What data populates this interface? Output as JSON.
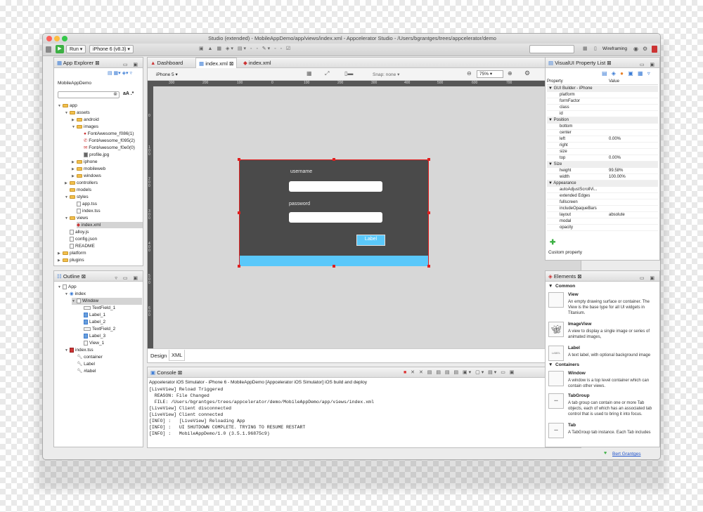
{
  "window": {
    "title": "Studio (extended) - MobileAppDemo/app/views/index.xml - Appcelerator Studio - /Users/bgrantges/trees/appcelerator/demo"
  },
  "toolbar": {
    "run_label": "Run",
    "device_label": "iPhone 6 (v8.3)",
    "wireframing_label": "Wireframing"
  },
  "explorer": {
    "title": "App Explorer",
    "project": "MobileAppDemo",
    "filter_buttons": "aA .*",
    "items": [
      "app",
      "assets",
      "android",
      "images",
      "FontAwesome_f086(1)",
      "FontAwesome_f095(2)",
      "FontAwesome_f0e0(0)",
      "profile.jpg",
      "iphone",
      "mobileweb",
      "windows",
      "controllers",
      "models",
      "styles",
      "app.tss",
      "index.tss",
      "views",
      "index.xml",
      "alloy.js",
      "config.json",
      "README",
      "platform",
      "plugins"
    ]
  },
  "outline": {
    "title": "Outline",
    "items": [
      "App",
      "index",
      "Window",
      "TextField_1",
      "Label_1",
      "Label_2",
      "TextField_2",
      "Label_3",
      "View_1",
      "index.tss",
      "container",
      "Label",
      "#label"
    ]
  },
  "editor": {
    "tabs": [
      "Dashboard",
      "index.xml",
      "index.xml"
    ],
    "device": "iPhone 5",
    "snap": "Snap: none",
    "zoom": "75%",
    "ruler_top": [
      "300",
      "200",
      "100",
      "0",
      "100",
      "200",
      "300",
      "400",
      "500",
      "600",
      "700"
    ],
    "ruler_left": [
      "0",
      "1\n0\n0",
      "2\n0\n0",
      "3\n0\n0",
      "4\n0\n0",
      "5\n0\n0",
      "6\n0\n0"
    ],
    "username_label": "username",
    "password_label": "password",
    "button_label": "Label",
    "bottom_tabs": [
      "Design",
      "XML"
    ]
  },
  "console": {
    "title": "Console",
    "header": "Appcelerator iOS Simulator - iPhone 6 - MobileAppDemo [Appcelerator iOS Simulator] iOS build and deploy",
    "lines": [
      "[LiveView] Reload Triggered",
      "  REASON: File Changed",
      "  FILE: /Users/bgrantges/trees/appcelerator/demo/MobileAppDemo/app/views/index.xml",
      "[LiveView] Client disconnected",
      "[LiveView] Client connected",
      "[INFO] :   [LiveView] Reloading App",
      "[INFO] :   UI SHUTDOWN COMPLETE. TRYING TO RESUME RESTART",
      "[INFO] :   MobileAppDemo/1.0 (3.5.1.96875c9)"
    ]
  },
  "properties": {
    "title": "VisualUI Property List",
    "col_property": "Property",
    "col_value": "Value",
    "rows": [
      {
        "name": "GUI Builder - iPhone",
        "value": "",
        "group": true
      },
      {
        "name": "platform",
        "value": ""
      },
      {
        "name": "formFactor",
        "value": ""
      },
      {
        "name": "class",
        "value": ""
      },
      {
        "name": "id",
        "value": ""
      },
      {
        "name": "Position",
        "value": "",
        "group": true
      },
      {
        "name": "bottom",
        "value": ""
      },
      {
        "name": "center",
        "value": ""
      },
      {
        "name": "left",
        "value": "0.00%"
      },
      {
        "name": "right",
        "value": ""
      },
      {
        "name": "size",
        "value": ""
      },
      {
        "name": "top",
        "value": "0.00%"
      },
      {
        "name": "Size",
        "value": "",
        "group": true
      },
      {
        "name": "height",
        "value": "99.58%"
      },
      {
        "name": "width",
        "value": "100.00%"
      },
      {
        "name": "Appearance",
        "value": "",
        "group": true
      },
      {
        "name": "autoAdjustScrollVi...",
        "value": ""
      },
      {
        "name": "extended Edges",
        "value": ""
      },
      {
        "name": "fullscreen",
        "value": ""
      },
      {
        "name": "includeOpaqueBars",
        "value": ""
      },
      {
        "name": "layout",
        "value": "absolute"
      },
      {
        "name": "modal",
        "value": ""
      },
      {
        "name": "opacity",
        "value": ""
      }
    ],
    "custom_property": "Custom property"
  },
  "elements": {
    "title": "Elements",
    "common": "Common",
    "containers": "Containers",
    "items": [
      {
        "name": "View",
        "desc": "An empty drawing surface or container. The View is the base type for all UI widgets in Titanium."
      },
      {
        "name": "ImageView",
        "desc": "A view to display a single image or series of animated images,"
      },
      {
        "name": "Label",
        "desc": "A text label, with optional background image"
      },
      {
        "name": "Window",
        "desc": "A window is a top level container which can contain other views."
      },
      {
        "name": "TabGroup",
        "desc": "A tab group can contain one or more Tab objects, each of which has an associated tab control that is used to bring it into focus."
      },
      {
        "name": "Tab",
        "desc": "A TabGroup tab instance. Each Tab includes"
      }
    ]
  },
  "status": {
    "user": "Bert Grantges"
  },
  "colors": {
    "accent": "#5ac8fa",
    "canvas": "#4a4a4a",
    "selection": "#e02020"
  }
}
